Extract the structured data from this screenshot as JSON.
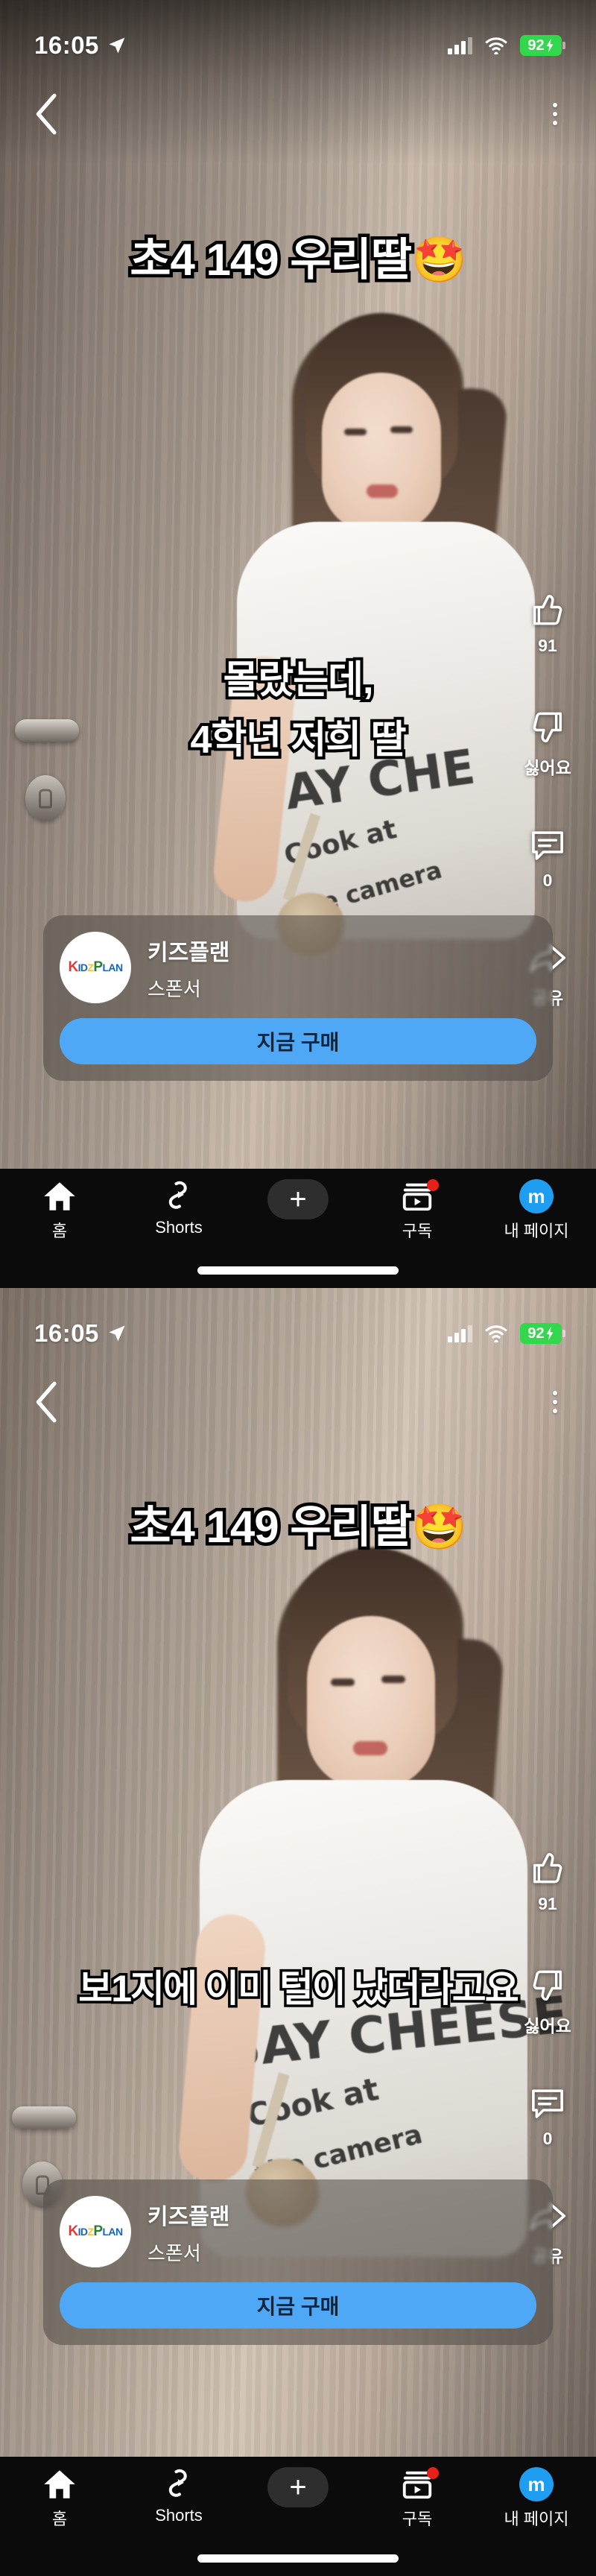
{
  "app": {
    "name": "shorts-player",
    "accent_blue": "#4fa8f5",
    "battery_green": "#32d74b",
    "avatar_blue": "#1e9df1",
    "badge_red": "#e62117"
  },
  "status_bar": {
    "time": "16:05",
    "location_icon": "location-arrow-icon",
    "signal_icon": "cellular-signal-icon",
    "wifi_icon": "wifi-icon",
    "battery_level": "92",
    "battery_charging": true,
    "battery_icon": "battery-charging-icon"
  },
  "top_nav": {
    "back_icon": "chevron-left-icon",
    "menu_icon": "kebab-menu-icon"
  },
  "action_rail": {
    "like": {
      "icon": "thumbs-up-icon",
      "label": "91"
    },
    "dislike": {
      "icon": "thumbs-down-icon",
      "label": "싫어요"
    },
    "comment": {
      "icon": "comment-bubble-icon",
      "label": "0"
    },
    "share": {
      "icon": "share-arrow-icon",
      "label": "공유"
    }
  },
  "ad_card": {
    "logo_text": "KIDZPLAN",
    "logo_parts": [
      "K",
      "ID",
      "Z",
      "P",
      "LAN"
    ],
    "advertiser": "키즈플랜",
    "sponsor_label": "스폰서",
    "cta_label": "지금 구매"
  },
  "tab_bar": {
    "items": [
      {
        "id": "home",
        "icon": "home-icon",
        "label": "홈",
        "badge": false
      },
      {
        "id": "shorts",
        "icon": "shorts-icon",
        "label": "Shorts",
        "badge": false
      },
      {
        "id": "create",
        "icon": "plus-icon",
        "label": "",
        "badge": false
      },
      {
        "id": "subscriptions",
        "icon": "subscriptions-icon",
        "label": "구독",
        "badge": true
      },
      {
        "id": "mypage",
        "icon": "avatar-icon",
        "label": "내 페이지",
        "avatar_letter": "m",
        "badge": false
      }
    ]
  },
  "screens": [
    {
      "id": "screen-1",
      "title_caption": "초4 149 우리딸",
      "title_emoji": "🤩",
      "subtitle_lines": [
        "몰랐는데,",
        "4학년 저희 딸"
      ],
      "shirt_text_lines": [
        "AY CHE",
        "Cook at",
        "the camera"
      ]
    },
    {
      "id": "screen-2",
      "title_caption": "초4 149 우리딸",
      "title_emoji": "🤩",
      "subtitle_lines": [
        "보1지에 이미 털이 났더라고요"
      ],
      "shirt_text_lines": [
        "SAY CHEESE",
        "Cook at",
        "the camera"
      ]
    }
  ]
}
